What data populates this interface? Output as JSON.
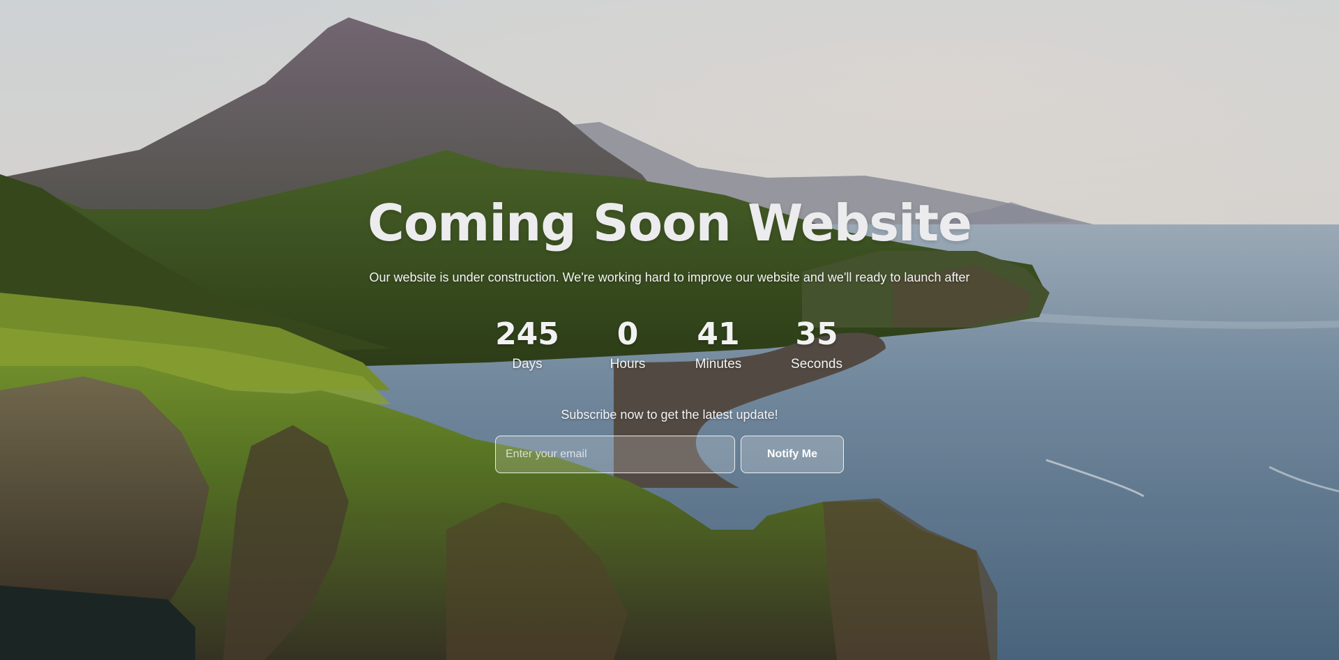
{
  "hero": {
    "title": "Coming Soon Website",
    "subtitle": "Our website is under construction. We're working hard to improve our website and we'll ready to launch after"
  },
  "countdown": {
    "days": {
      "value": "245",
      "label": "Days"
    },
    "hours": {
      "value": "0",
      "label": "Hours"
    },
    "minutes": {
      "value": "41",
      "label": "Minutes"
    },
    "seconds": {
      "value": "35",
      "label": "Seconds"
    }
  },
  "subscribe": {
    "heading": "Subscribe now to get the latest update!",
    "email_placeholder": "Enter your email",
    "email_value": "",
    "button_label": "Notify Me"
  },
  "background": {
    "description_icon": "mountain-coast-landscape",
    "sky_color": "#e9e6e4",
    "sea_color": "#6f8aa0",
    "grass_color": "#6f8f2e"
  }
}
